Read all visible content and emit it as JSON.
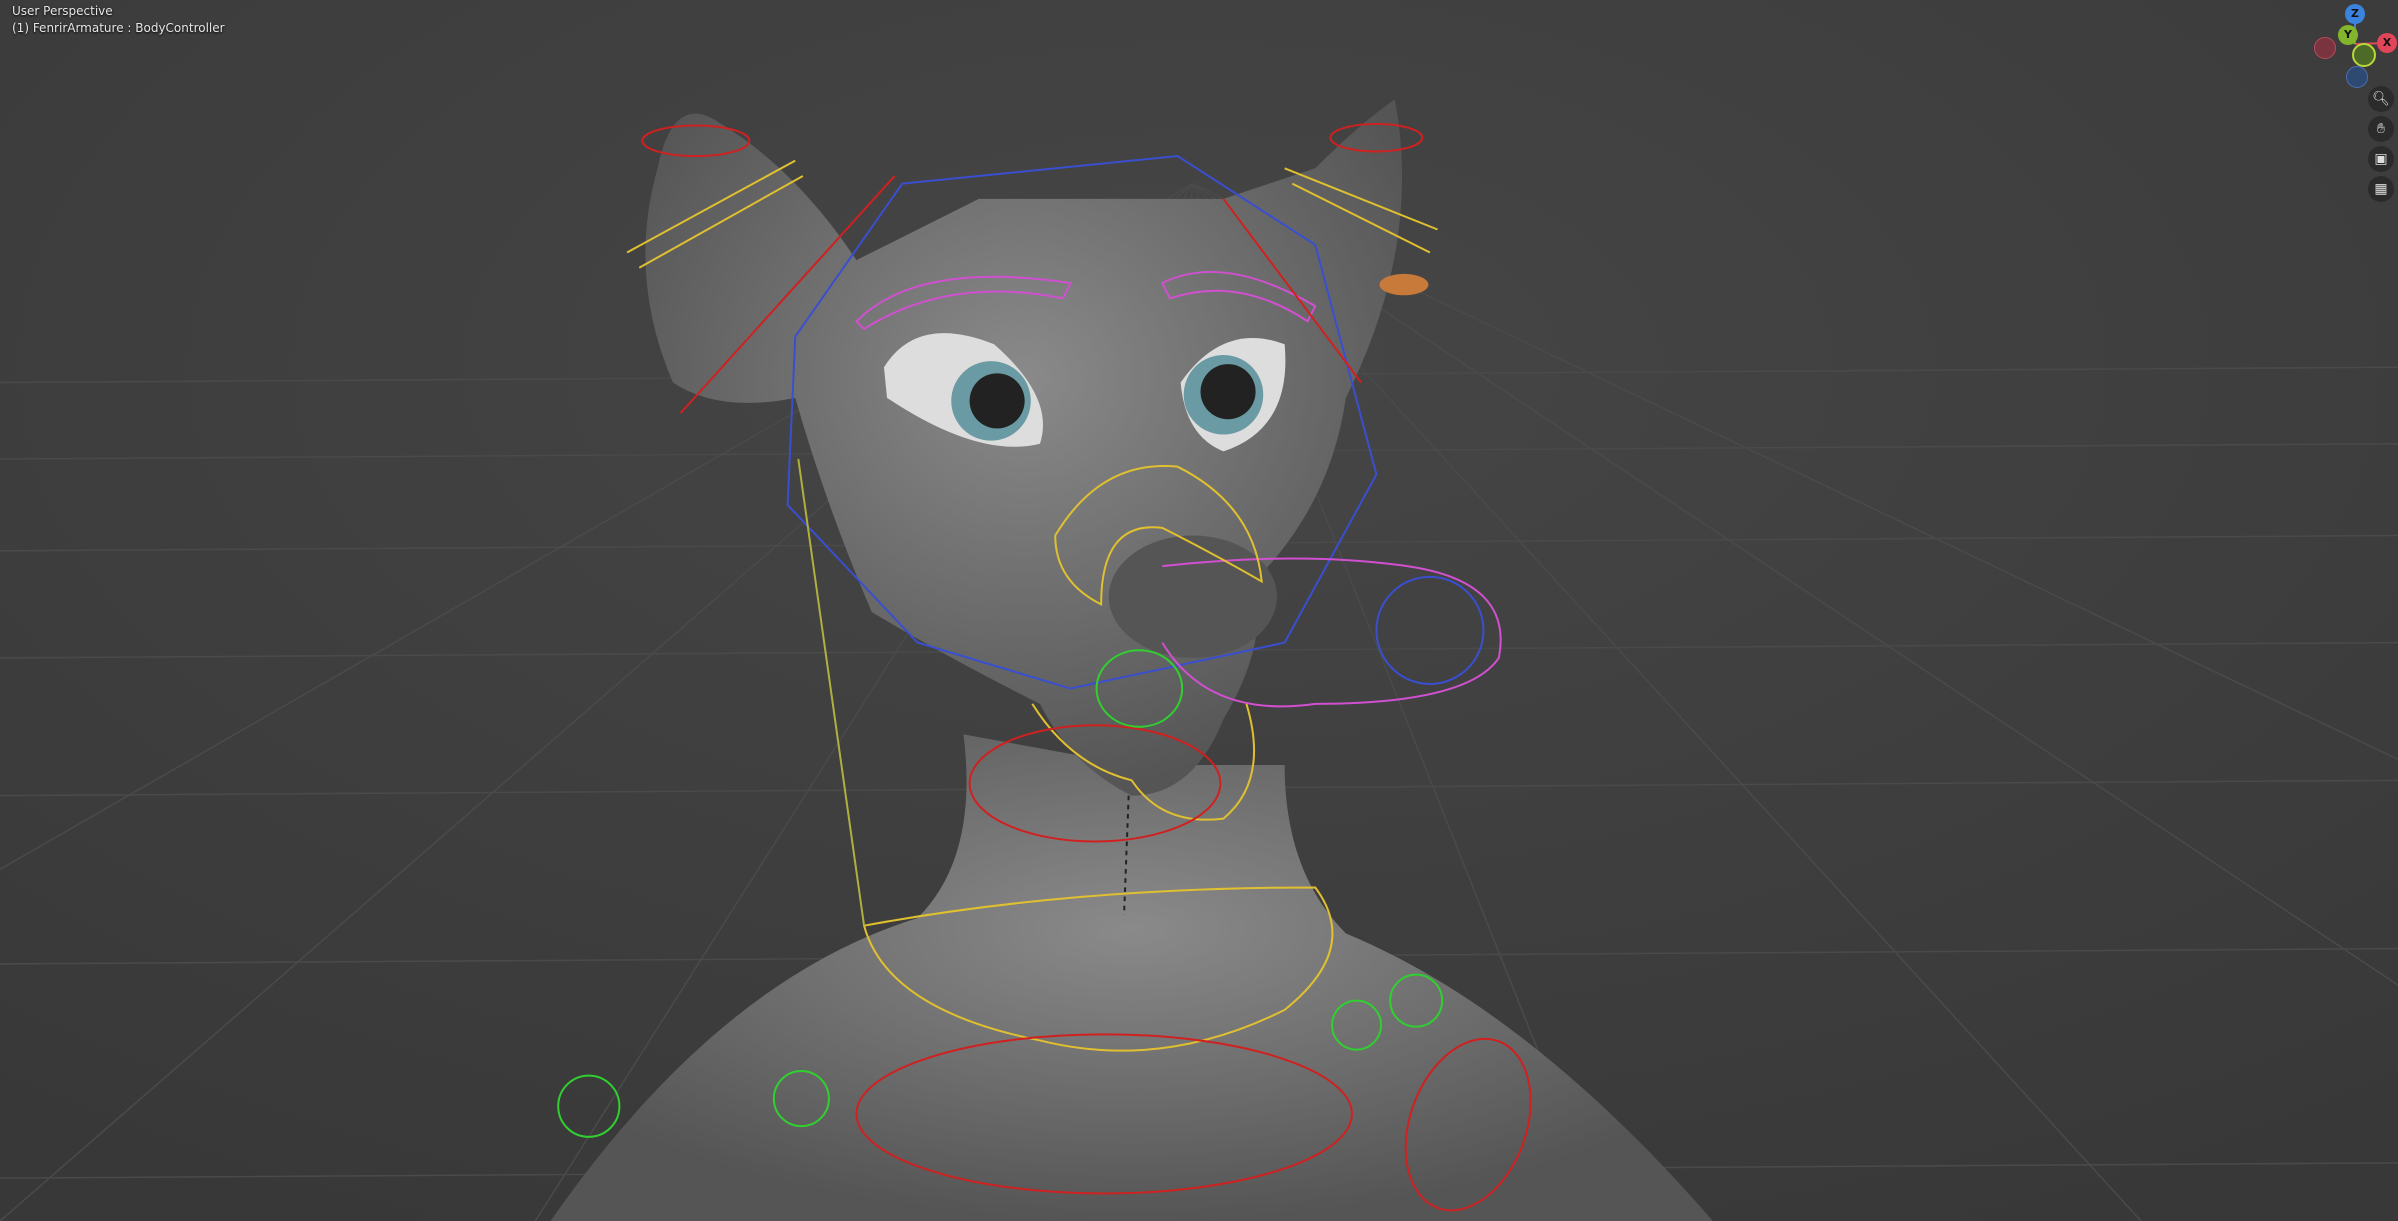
{
  "viewport": {
    "view_name": "User Perspective",
    "active_object": "(1) FenrirArmature : BodyController"
  },
  "gizmo": {
    "z_label": "Z",
    "y_label": "Y",
    "x_label": "X",
    "colors": {
      "x": "#e0455a",
      "y": "#82b52c",
      "z": "#3c83e0"
    }
  },
  "nav_buttons": [
    {
      "icon": "zoom-icon"
    },
    {
      "icon": "hand-pan-icon"
    },
    {
      "icon": "camera-icon"
    },
    {
      "icon": "grid-ortho-icon"
    }
  ]
}
